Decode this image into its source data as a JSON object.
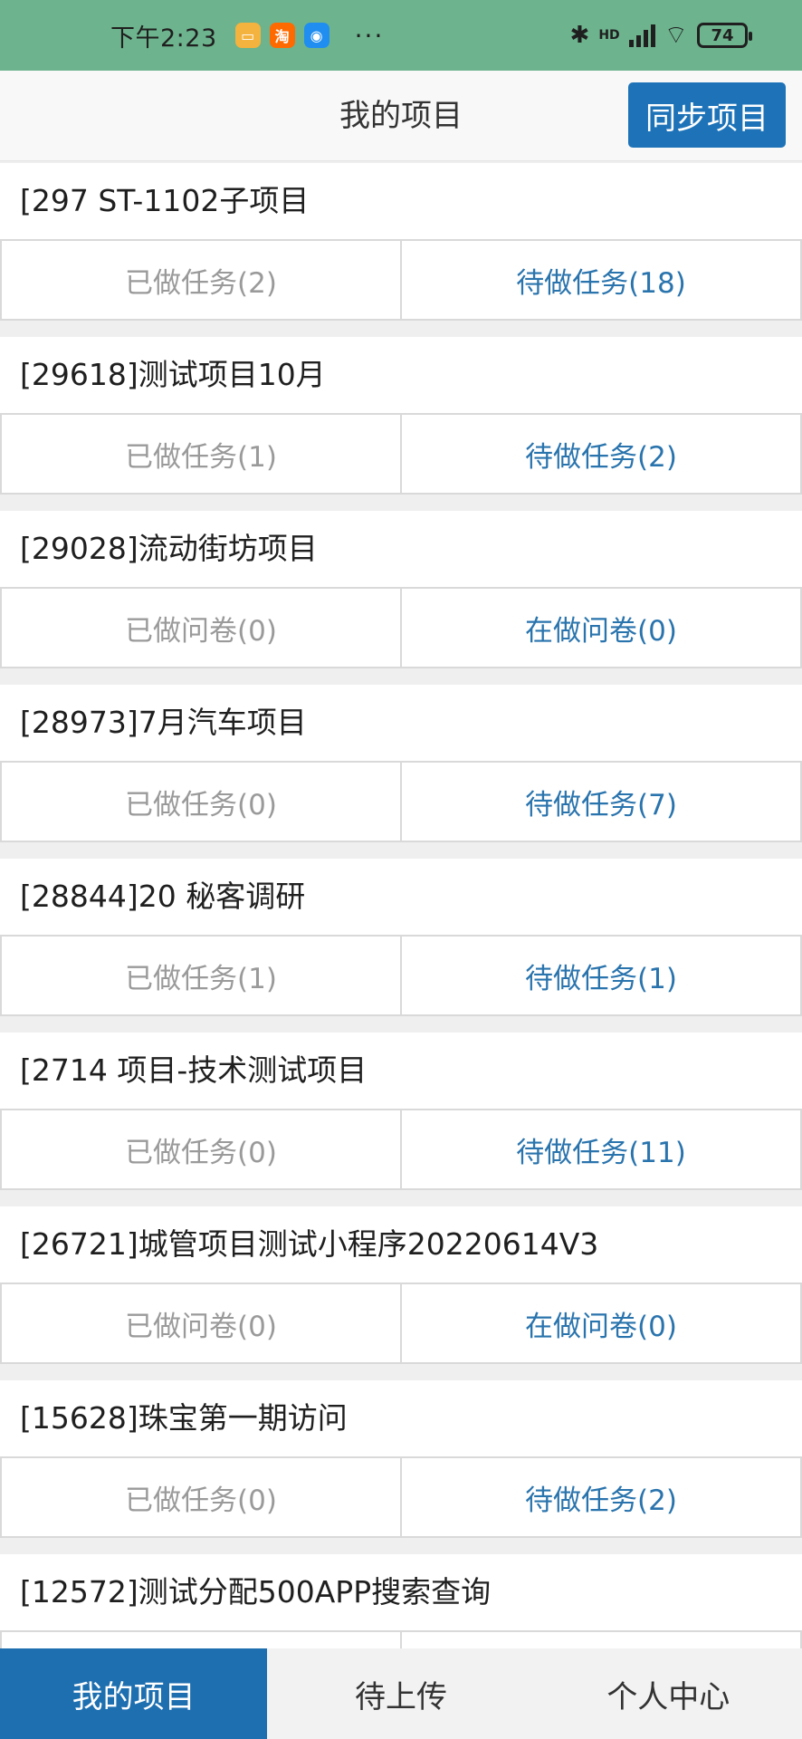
{
  "status_bar": {
    "time": "下午2:23",
    "apps": [
      "notification-app-icon",
      "taobao-icon",
      "browser-icon"
    ],
    "more": "···",
    "network": "HD",
    "battery": "74"
  },
  "header": {
    "title": "我的项目",
    "sync_label": "同步项目"
  },
  "projects": [
    {
      "title": "[297          ST-1102子项目",
      "done": "已做任务(2)",
      "todo": "待做任务(18)"
    },
    {
      "title": "[29618]测试项目10月",
      "done": "已做任务(1)",
      "todo": "待做任务(2)"
    },
    {
      "title": "[29028]流动街坊项目",
      "done": "已做问卷(0)",
      "todo": "在做问卷(0)"
    },
    {
      "title": "[28973]7月汽车项目",
      "done": "已做任务(0)",
      "todo": "待做任务(7)"
    },
    {
      "title": "[28844]20        秘客调研",
      "done": "已做任务(1)",
      "todo": "待做任务(1)"
    },
    {
      "title": "[2714         项目-技术测试项目",
      "done": "已做任务(0)",
      "todo": "待做任务(11)"
    },
    {
      "title": "[26721]城管项目测试小程序20220614V3",
      "done": "已做问卷(0)",
      "todo": "在做问卷(0)"
    },
    {
      "title": "[15628]珠宝第一期访问",
      "done": "已做任务(0)",
      "todo": "待做任务(2)"
    },
    {
      "title": "[12572]测试分配500APP搜索查询",
      "done": "",
      "todo": ""
    }
  ],
  "bottom_nav": [
    {
      "label": "我的项目",
      "active": true
    },
    {
      "label": "待上传",
      "active": false
    },
    {
      "label": "个人中心",
      "active": false
    }
  ],
  "colors": {
    "status_bar_bg": "#6db38e",
    "accent": "#1e73b8",
    "todo_text": "#2a74ad",
    "done_text": "#9a9a9a"
  }
}
